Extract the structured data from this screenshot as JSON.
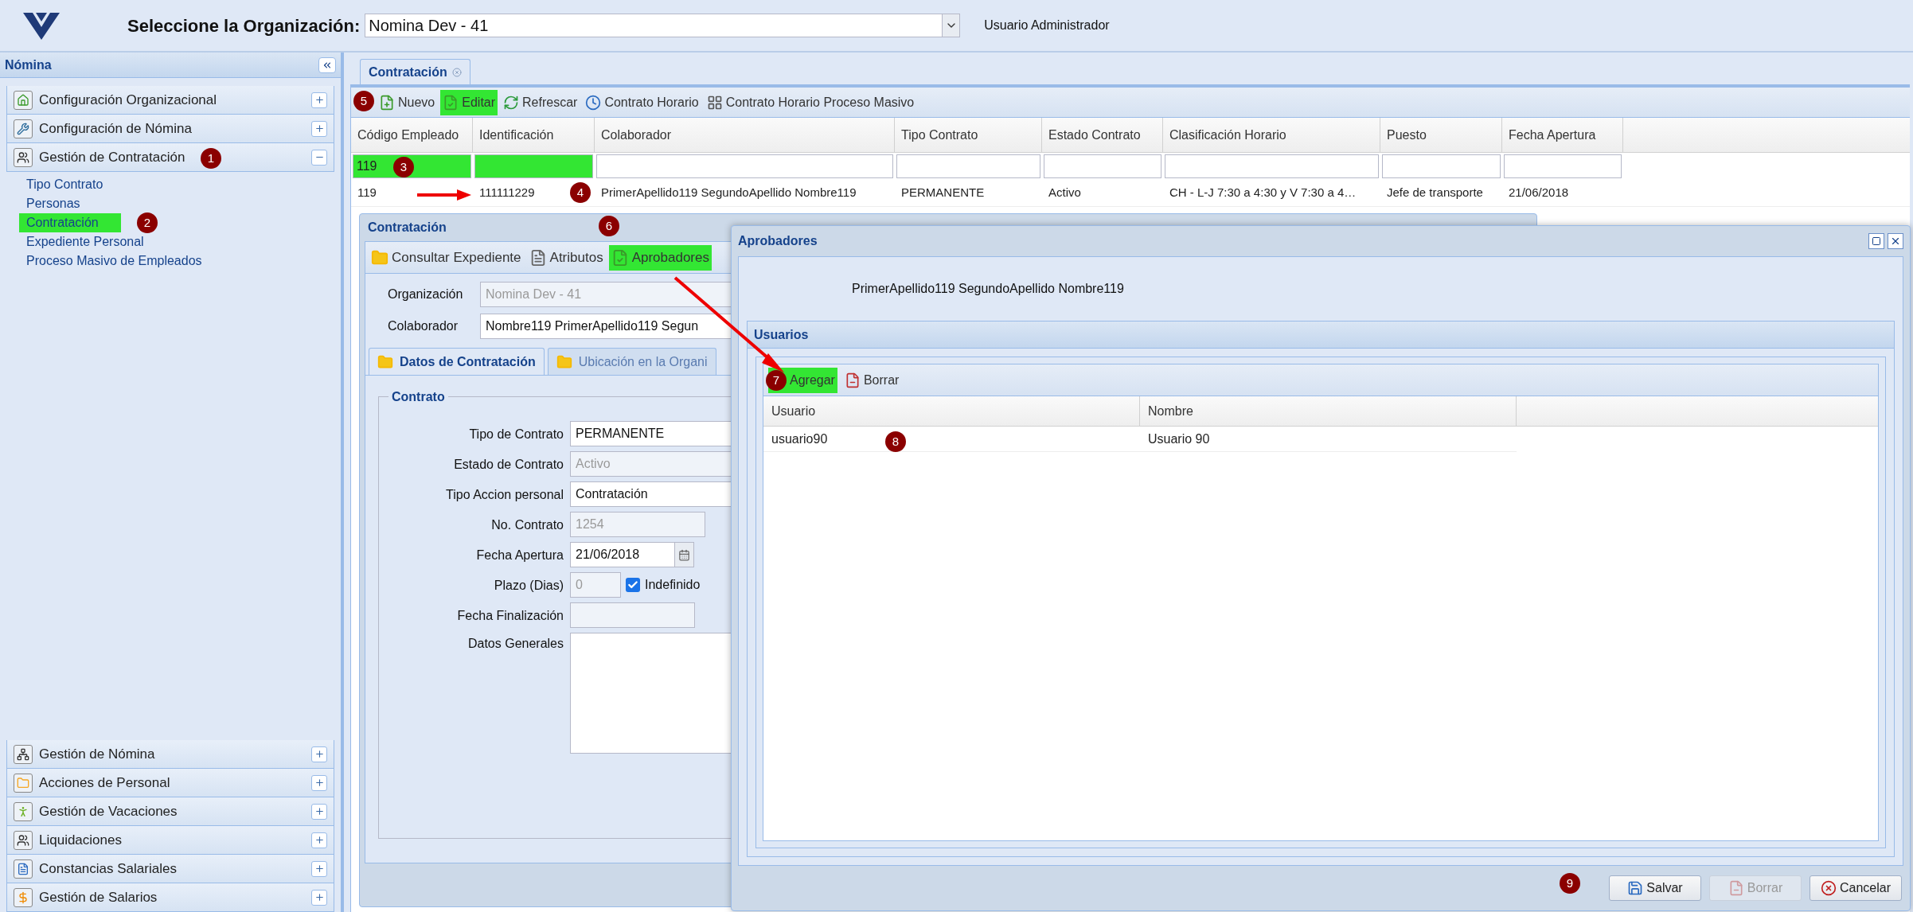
{
  "header": {
    "title": "Seleccione la Organización:",
    "organization": "Nomina Dev - 41",
    "user": "Usuario Administrador"
  },
  "sidebar": {
    "title": "Nómina",
    "sections": [
      {
        "label": "Configuración Organizacional",
        "expanded": false
      },
      {
        "label": "Configuración de Nómina",
        "expanded": false
      },
      {
        "label": "Gestión de Contratación",
        "expanded": true,
        "children": [
          {
            "label": "Tipo Contrato",
            "highlighted": false
          },
          {
            "label": "Personas",
            "highlighted": false
          },
          {
            "label": "Contratación",
            "highlighted": true
          },
          {
            "label": "Expediente Personal",
            "highlighted": false
          },
          {
            "label": "Proceso Masivo de Empleados",
            "highlighted": false
          }
        ]
      },
      {
        "label": "Gestión de Nómina",
        "expanded": false
      },
      {
        "label": "Acciones de Personal",
        "expanded": false
      },
      {
        "label": "Gestión de Vacaciones",
        "expanded": false
      },
      {
        "label": "Liquidaciones",
        "expanded": false
      },
      {
        "label": "Constancias Salariales",
        "expanded": false
      },
      {
        "label": "Gestión de Salarios",
        "expanded": false
      }
    ]
  },
  "tab": {
    "label": "Contratación"
  },
  "toolbar": [
    {
      "label": "Nuevo",
      "highlighted": false
    },
    {
      "label": "Editar",
      "highlighted": true
    },
    {
      "label": "Refrescar",
      "highlighted": false
    },
    {
      "label": "Contrato Horario",
      "highlighted": false
    },
    {
      "label": "Contrato Horario Proceso Masivo",
      "highlighted": false
    }
  ],
  "grid": {
    "columns": [
      "Código Empleado",
      "Identificación",
      "Colaborador",
      "Tipo Contrato",
      "Estado Contrato",
      "Clasificación Horario",
      "Puesto",
      "Fecha Apertura"
    ],
    "filters": [
      {
        "value": "119",
        "highlighted": true
      },
      {
        "highlighted": true
      },
      {
        "highlighted": false
      },
      {
        "highlighted": false
      },
      {
        "highlighted": false
      },
      {
        "highlighted": false
      },
      {
        "highlighted": false
      },
      {
        "highlighted": false
      }
    ],
    "rows": [
      [
        "119",
        "111111229",
        "PrimerApellido119 SegundoApellido Nombre119",
        "PERMANENTE",
        "Activo",
        "CH - L-J 7:30 a 4:30 y V 7:30 a 4…",
        "Jefe de transporte",
        "21/06/2018"
      ]
    ]
  },
  "detail": {
    "title": "Contratación",
    "toolbar": [
      {
        "label": "Consultar Expediente",
        "highlighted": false
      },
      {
        "label": "Atributos",
        "highlighted": false
      },
      {
        "label": "Aprobadores",
        "highlighted": true
      }
    ],
    "header_fields": [
      {
        "label": "Organización",
        "value": "Nomina Dev - 41",
        "disabled": true
      },
      {
        "label": "Colaborador",
        "value": "Nombre119 PrimerApellido119 Segun",
        "disabled": false
      }
    ],
    "tabs": [
      {
        "label": "Datos de Contratación",
        "selected": true
      },
      {
        "label": "Ubicación en la Organi",
        "selected": false
      }
    ],
    "fieldset": "Contrato",
    "fields": [
      {
        "kind": "text",
        "label": "Tipo de Contrato",
        "value": "PERMANENTE",
        "disabled": false
      },
      {
        "kind": "text",
        "label": "Estado de Contrato",
        "value": "Activo",
        "disabled": true
      },
      {
        "kind": "text",
        "label": "Tipo Accion personal",
        "value": "Contratación",
        "disabled": false
      },
      {
        "kind": "text",
        "label": "No. Contrato",
        "value": "1254",
        "disabled": true
      },
      {
        "kind": "date",
        "label": "Fecha Apertura",
        "value": "21/06/2018",
        "disabled": false
      },
      {
        "kind": "check",
        "label": "Plazo (Dias)",
        "value": "0",
        "disabled": true,
        "check_label": "Indefinido",
        "checked": true
      },
      {
        "kind": "text",
        "label": "Fecha Finalización",
        "disabled": true
      },
      {
        "kind": "textarea",
        "label": "Datos Generales",
        "disabled": false
      }
    ]
  },
  "approvers": {
    "title": "Aprobadores",
    "employee": "PrimerApellido119 SegundoApellido Nombre119",
    "panel_title": "Usuarios",
    "toolbar": [
      {
        "label": "Agregar",
        "highlighted": true
      },
      {
        "label": "Borrar",
        "highlighted": false
      }
    ],
    "columns": [
      "Usuario",
      "Nombre"
    ],
    "rows": [
      [
        "usuario90",
        "Usuario 90"
      ]
    ],
    "buttons": [
      {
        "label": "Salvar",
        "disabled": false
      },
      {
        "label": "Borrar",
        "disabled": true
      },
      {
        "label": "Cancelar",
        "disabled": false
      }
    ]
  },
  "annotations": [
    "1",
    "2",
    "3",
    "4",
    "5",
    "6",
    "7",
    "8",
    "9"
  ]
}
